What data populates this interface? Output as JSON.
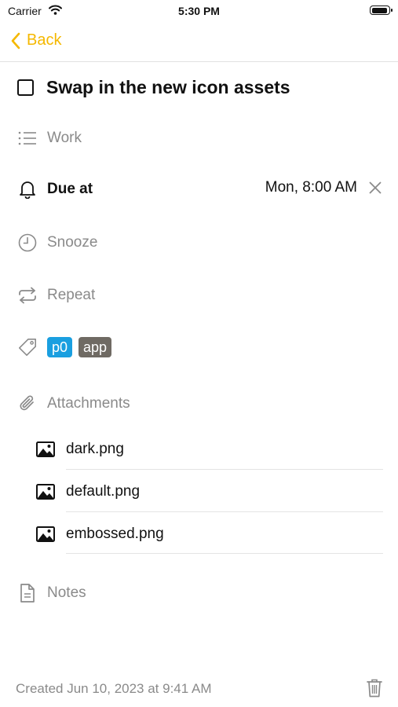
{
  "status_bar": {
    "carrier": "Carrier",
    "time": "5:30 PM"
  },
  "nav": {
    "back_label": "Back"
  },
  "task": {
    "title": "Swap in the new icon assets",
    "completed": false
  },
  "list": {
    "name": "Work",
    "icon": "list-icon"
  },
  "due": {
    "label": "Due at",
    "value": "Mon, 8:00 AM",
    "icon": "bell-icon"
  },
  "snooze": {
    "label": "Snooze",
    "icon": "clock-icon"
  },
  "repeat": {
    "label": "Repeat",
    "icon": "repeat-icon"
  },
  "tags": [
    {
      "label": "p0",
      "color": "#1a9fe0"
    },
    {
      "label": "app",
      "color": "#6f6a63"
    }
  ],
  "attachments": {
    "label": "Attachments",
    "items": [
      {
        "name": "dark.png"
      },
      {
        "name": "default.png"
      },
      {
        "name": "embossed.png"
      }
    ]
  },
  "notes": {
    "label": "Notes"
  },
  "footer": {
    "created": "Created Jun 10, 2023 at 9:41 AM"
  },
  "colors": {
    "accent": "#f5b800",
    "muted": "#8a8a8a"
  }
}
